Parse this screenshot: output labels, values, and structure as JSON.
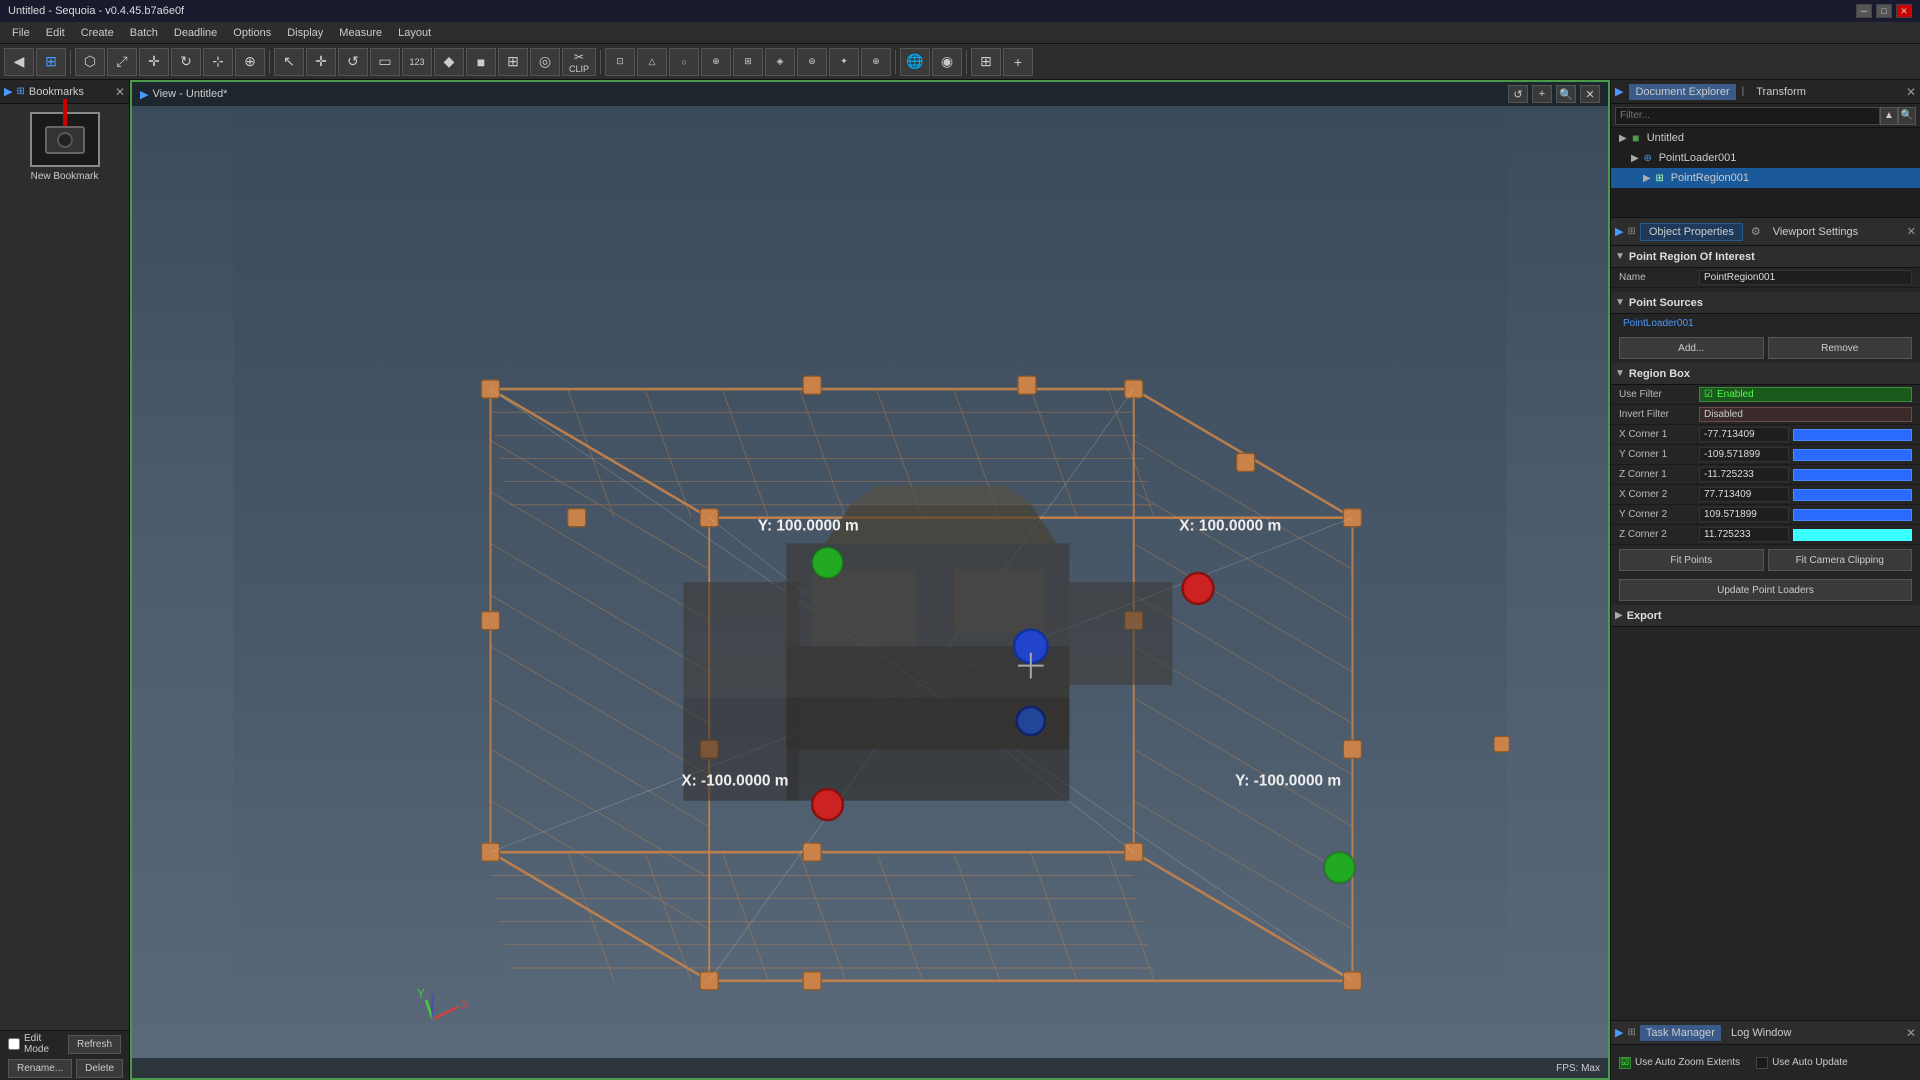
{
  "title_bar": {
    "title": "Untitled - Sequoia - v0.4.45.b7a6e0f",
    "minimize": "─",
    "maximize": "□",
    "close": "✕"
  },
  "menu": {
    "items": [
      "File",
      "Edit",
      "Create",
      "Batch",
      "Deadline",
      "Options",
      "Display",
      "Measure",
      "Layout"
    ]
  },
  "toolbar": {
    "clip_label": "CLIP"
  },
  "left_panel": {
    "tab_label": "Bookmarks",
    "new_bookmark": "New Bookmark",
    "edit_mode": "Edit Mode",
    "refresh": "Refresh",
    "rename": "Rename...",
    "delete": "Delete"
  },
  "viewport": {
    "title": "View - Untitled*",
    "fps_label": "FPS: Max",
    "coord_y_pos": "Y: 100.0000 m",
    "coord_x_pos": "X: 100.0000 m",
    "coord_x_neg": "X: -100.0000 m",
    "coord_y_neg": "Y: -100.0000 m"
  },
  "document_explorer": {
    "filter_placeholder": "Filter...",
    "tree": [
      {
        "id": "untitled",
        "label": "Untitled",
        "indent": 0,
        "type": "root",
        "expanded": true
      },
      {
        "id": "pointloader001",
        "label": "PointLoader001",
        "indent": 1,
        "type": "pointcloud",
        "expanded": false
      },
      {
        "id": "pointregion001",
        "label": "PointRegion001",
        "indent": 2,
        "type": "region",
        "selected": true,
        "expanded": false
      }
    ]
  },
  "properties": {
    "tab_label": "Object Properties",
    "viewport_settings_label": "Viewport Settings",
    "section_title": "Point Region Of Interest",
    "name_label": "Name",
    "name_value": "PointRegion001",
    "point_sources_section": "Point Sources",
    "point_source_item": "PointLoader001",
    "add_btn": "Add...",
    "remove_btn": "Remove",
    "region_box_section": "Region Box",
    "use_filter_label": "Use Filter",
    "use_filter_value": "Enabled",
    "invert_filter_label": "Invert Filter",
    "invert_filter_value": "Disabled",
    "x_corner1_label": "X Corner 1",
    "x_corner1_value": "-77.713409",
    "y_corner1_label": "Y Corner 1",
    "y_corner1_value": "-109.571899",
    "z_corner1_label": "Z Corner 1",
    "z_corner1_value": "-11.725233",
    "x_corner2_label": "X Corner 2",
    "x_corner2_value": "77.713409",
    "y_corner2_label": "Y Corner 2",
    "y_corner2_value": "109.571899",
    "z_corner2_label": "Z Corner 2",
    "z_corner2_value": "11.725233",
    "fit_points_btn": "Fit Points",
    "fit_camera_btn": "Fit Camera Clipping",
    "update_btn": "Update Point Loaders",
    "export_section": "Export"
  },
  "task_manager": {
    "task_tab": "Task Manager",
    "log_tab": "Log Window",
    "auto_zoom_label": "Use Auto Zoom Extents",
    "auto_update_label": "Use Auto Update"
  }
}
